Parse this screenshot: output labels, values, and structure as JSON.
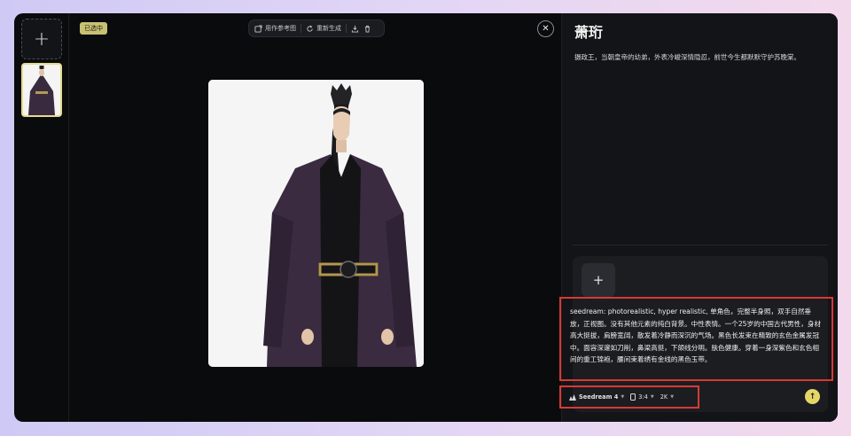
{
  "left_rail": {
    "add_icon": "plus-icon",
    "add_glyph": "+"
  },
  "stage": {
    "selected_badge": "已选中",
    "toolbar": {
      "use_as_reference": "用作参考图",
      "regenerate": "重新生成",
      "download_icon": "download-icon",
      "delete_icon": "trash-icon"
    },
    "close_glyph": "✕"
  },
  "panel": {
    "title": "萧珩",
    "description": "摄政王，当朝皇帝的幼弟，外表冷峻深情隐忍，前世今生都默默守护苏晚棠。",
    "ref_add_glyph": "+",
    "prompt": "seedream: photorealistic, hyper realistic, 单角色，完整半身照，双手自然垂放，正视图。没有其他元素的纯白背景。中性表情。一个25岁的中国古代男性，身材高大挺拔，肩膀宽阔，散发着冷静而深沉的气场。黑色长发束在精致的玄色金属发冠中。面容深邃如刀削，鼻梁高挺，下颌线分明。肤色健康。穿着一身深紫色和玄色相间的重工锦袍，腰间束着绣有金线的黑色玉带。",
    "settings": {
      "model": "Seedream 4",
      "ratio": "3:4",
      "resolution": "2K"
    },
    "send_glyph": "↑"
  },
  "colors": {
    "accent_yellow": "#e5d568",
    "highlight_red": "#d73a36",
    "badge_bg": "#c8c173",
    "robe_purple": "#3a2a40"
  }
}
